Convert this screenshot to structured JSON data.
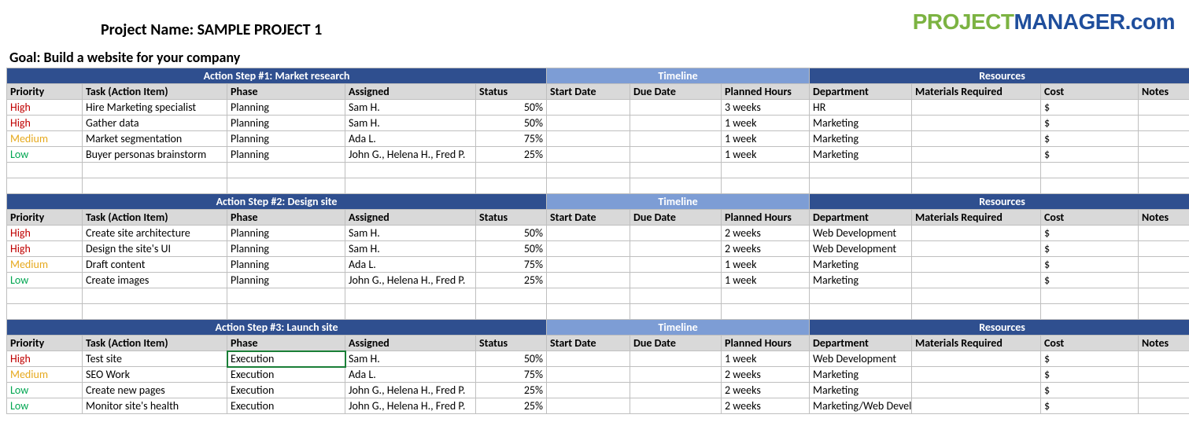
{
  "project_name_label": "Project Name: SAMPLE PROJECT 1",
  "goal_label": "Goal: Build a website for your company",
  "logo": {
    "part1": "PROJECT",
    "part2": "MANAGER",
    "part3": ".com"
  },
  "section_headers": {
    "timeline": "Timeline",
    "resources": "Resources"
  },
  "column_headers": {
    "priority": "Priority",
    "task": "Task (Action Item)",
    "phase": "Phase",
    "assigned": "Assigned",
    "status": "Status",
    "start": "Start Date",
    "due": "Due Date",
    "planned": "Planned Hours",
    "dept": "Department",
    "materials": "Materials Required",
    "cost": "Cost",
    "notes": "Notes"
  },
  "chart_data": {
    "type": "table",
    "steps": [
      {
        "title": "Action Step #1: Market research",
        "rows": [
          {
            "priority": "High",
            "task": "Hire Marketing specialist",
            "phase": "Planning",
            "assigned": "Sam H.",
            "status": "50%",
            "start": "",
            "due": "",
            "planned": "3 weeks",
            "dept": "HR",
            "materials": "",
            "cost": "$",
            "notes": ""
          },
          {
            "priority": "High",
            "task": "Gather data",
            "phase": "Planning",
            "assigned": "Sam H.",
            "status": "50%",
            "start": "",
            "due": "",
            "planned": "1 week",
            "dept": "Marketing",
            "materials": "",
            "cost": "$",
            "notes": ""
          },
          {
            "priority": "Medium",
            "task": "Market segmentation",
            "phase": "Planning",
            "assigned": "Ada L.",
            "status": "75%",
            "start": "",
            "due": "",
            "planned": "1 week",
            "dept": "Marketing",
            "materials": "",
            "cost": "$",
            "notes": ""
          },
          {
            "priority": "Low",
            "task": "Buyer personas brainstorm",
            "phase": "Planning",
            "assigned": "John G., Helena H., Fred P.",
            "status": "25%",
            "start": "",
            "due": "",
            "planned": "1 week",
            "dept": "Marketing",
            "materials": "",
            "cost": "$",
            "notes": ""
          }
        ]
      },
      {
        "title": "Action Step #2: Design site",
        "rows": [
          {
            "priority": "High",
            "task": "Create site architecture",
            "phase": "Planning",
            "assigned": "Sam H.",
            "status": "50%",
            "start": "",
            "due": "",
            "planned": "2 weeks",
            "dept": "Web Development",
            "materials": "",
            "cost": "$",
            "notes": ""
          },
          {
            "priority": "High",
            "task": "Design the site's UI",
            "phase": "Planning",
            "assigned": "Sam H.",
            "status": "50%",
            "start": "",
            "due": "",
            "planned": "2 weeks",
            "dept": "Web Development",
            "materials": "",
            "cost": "$",
            "notes": ""
          },
          {
            "priority": "Medium",
            "task": "Draft content",
            "phase": "Planning",
            "assigned": "Ada L.",
            "status": "75%",
            "start": "",
            "due": "",
            "planned": "1 week",
            "dept": "Marketing",
            "materials": "",
            "cost": "$",
            "notes": ""
          },
          {
            "priority": "Low",
            "task": "Create images",
            "phase": "Planning",
            "assigned": "John G., Helena H., Fred P.",
            "status": "25%",
            "start": "",
            "due": "",
            "planned": "1 week",
            "dept": "Marketing",
            "materials": "",
            "cost": "$",
            "notes": ""
          }
        ]
      },
      {
        "title": "Action Step #3: Launch site",
        "rows": [
          {
            "priority": "High",
            "task": "Test site",
            "phase": "Execution",
            "assigned": "Sam H.",
            "status": "50%",
            "start": "",
            "due": "",
            "planned": "1 week",
            "dept": "Web Development",
            "materials": "",
            "cost": "$",
            "notes": ""
          },
          {
            "priority": "Medium",
            "task": "SEO Work",
            "phase": "Execution",
            "assigned": "Ada L.",
            "status": "75%",
            "start": "",
            "due": "",
            "planned": "2 weeks",
            "dept": "Marketing",
            "materials": "",
            "cost": "$",
            "notes": ""
          },
          {
            "priority": "Low",
            "task": "Create new pages",
            "phase": "Execution",
            "assigned": "John G., Helena H., Fred P.",
            "status": "25%",
            "start": "",
            "due": "",
            "planned": "2 weeks",
            "dept": "Marketing",
            "materials": "",
            "cost": "$",
            "notes": ""
          },
          {
            "priority": "Low",
            "task": "Monitor site's health",
            "phase": "Execution",
            "assigned": "John G., Helena H., Fred P.",
            "status": "25%",
            "start": "",
            "due": "",
            "planned": "2 weeks",
            "dept": "Marketing/Web Development",
            "materials": "",
            "cost": "$",
            "notes": ""
          }
        ]
      }
    ],
    "selected_cell": {
      "step": 2,
      "row": 0,
      "col": "phase"
    }
  }
}
